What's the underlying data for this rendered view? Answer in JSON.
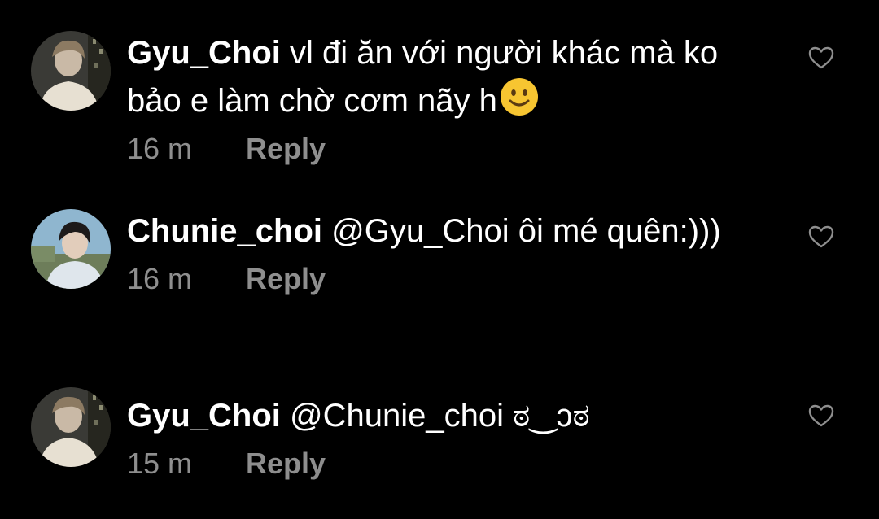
{
  "comments": [
    {
      "username": "Gyu_Choi",
      "text": "vl đi ăn với người khác mà ko bảo e làm chờ cơm nãy h",
      "emoji": "slightly-smiling-face",
      "time": "16 m",
      "reply_label": "Reply",
      "like_icon": "heart-outline-icon"
    },
    {
      "username": "Chunie_choi",
      "text": "@Gyu_Choi ôi mé quên:)))",
      "time": "16 m",
      "reply_label": "Reply",
      "like_icon": "heart-outline-icon"
    },
    {
      "username": "Gyu_Choi",
      "text": "@Chunie_choi ಠ‿ↄಠ",
      "time": "15 m",
      "reply_label": "Reply",
      "like_icon": "heart-outline-icon"
    }
  ],
  "colors": {
    "background": "#000000",
    "text": "#ffffff",
    "meta": "#8e8e8e",
    "emoji_face": "#f7c531"
  }
}
